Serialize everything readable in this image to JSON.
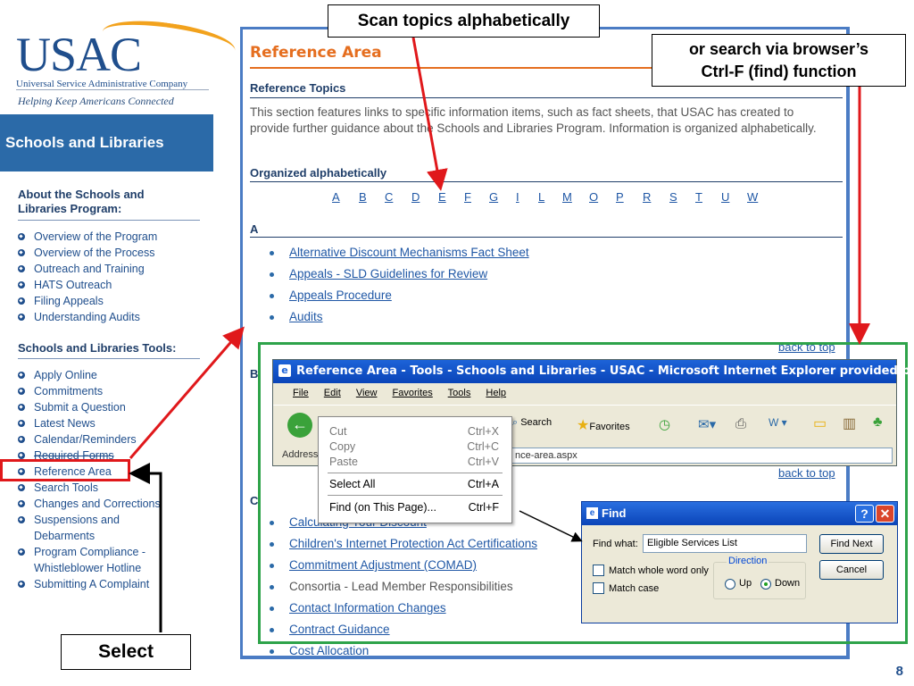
{
  "logo": {
    "text": "USAC",
    "subtitle": "Universal Service Administrative Company",
    "tagline": "Helping Keep Americans Connected"
  },
  "sidebar": {
    "banner": "Schools and Libraries",
    "about_heading": "About the Schools and Libraries Program:",
    "about_items": [
      "Overview of the Program",
      "Overview of the Process",
      "Outreach and Training",
      "HATS Outreach",
      "Filing Appeals",
      "Understanding Audits"
    ],
    "tools_heading": "Schools and Libraries Tools:",
    "tools_items": [
      "Apply Online",
      "Commitments",
      "Submit a Question",
      "Latest News",
      "Calendar/Reminders",
      "Required Forms",
      "Reference Area",
      "Search Tools",
      "Changes and Corrections",
      "Suspensions and",
      "Debarments",
      "Program Compliance -",
      "Whistleblower Hotline",
      "Submitting A Complaint"
    ]
  },
  "main": {
    "title": "Reference Area",
    "topics_heading": "Reference Topics",
    "intro": "This section features links to specific information items, such as fact sheets, that USAC has created to provide further guidance about the Schools and Libraries Program. Information is organized alphabetically.",
    "organized_heading": "Organized alphabetically",
    "letters": [
      "A",
      "B",
      "C",
      "D",
      "E",
      "F",
      "G",
      "I",
      "L",
      "M",
      "O",
      "P",
      "R",
      "S",
      "T",
      "U",
      "W"
    ],
    "section_a": "A",
    "a_links": [
      "Alternative Discount Mechanisms Fact Sheet",
      "Appeals - SLD Guidelines for Review",
      "Appeals Procedure",
      "Audits"
    ],
    "back_to_top": "back to top",
    "section_b": "B",
    "section_c": "C",
    "c_links": [
      "Calculating Your Discount",
      "Children's Internet Protection Act Certifications",
      "Commitment Adjustment (COMAD)",
      "Consortia - Lead Member Responsibilities",
      "Contact Information Changes",
      "Contract Guidance",
      "Cost Allocation"
    ]
  },
  "ie": {
    "title": "Reference Area - Tools - Schools and Libraries - USAC - Microsoft Internet Explorer provided by USAC",
    "menu": [
      "File",
      "Edit",
      "View",
      "Favorites",
      "Tools",
      "Help"
    ],
    "search_label": "Search",
    "favorites_label": "Favorites",
    "address_label": "Address",
    "address_value": "nce-area.aspx"
  },
  "context_menu": [
    {
      "label": "Cut",
      "key": "Ctrl+X"
    },
    {
      "label": "Copy",
      "key": "Ctrl+C"
    },
    {
      "label": "Paste",
      "key": "Ctrl+V"
    },
    {
      "label": "Select All",
      "key": "Ctrl+A"
    },
    {
      "label": "Find (on This Page)...",
      "key": "Ctrl+F"
    }
  ],
  "find": {
    "title": "Find",
    "find_what_label": "Find what:",
    "value": "Eligible Services List",
    "find_next": "Find Next",
    "cancel": "Cancel",
    "match_whole": "Match whole word only",
    "match_case": "Match case",
    "direction": "Direction",
    "up": "Up",
    "down": "Down"
  },
  "callouts": {
    "scan": "Scan topics alphabetically",
    "search_line1": "or search via browser’s",
    "search_line2": "Ctrl-F (find) function",
    "select": "Select"
  },
  "page_number": "8",
  "colors": {
    "brand_blue": "#1f4e8c",
    "orange": "#e56e1f",
    "annotation_red": "#e0181b",
    "frame_green": "#2ea34a"
  }
}
